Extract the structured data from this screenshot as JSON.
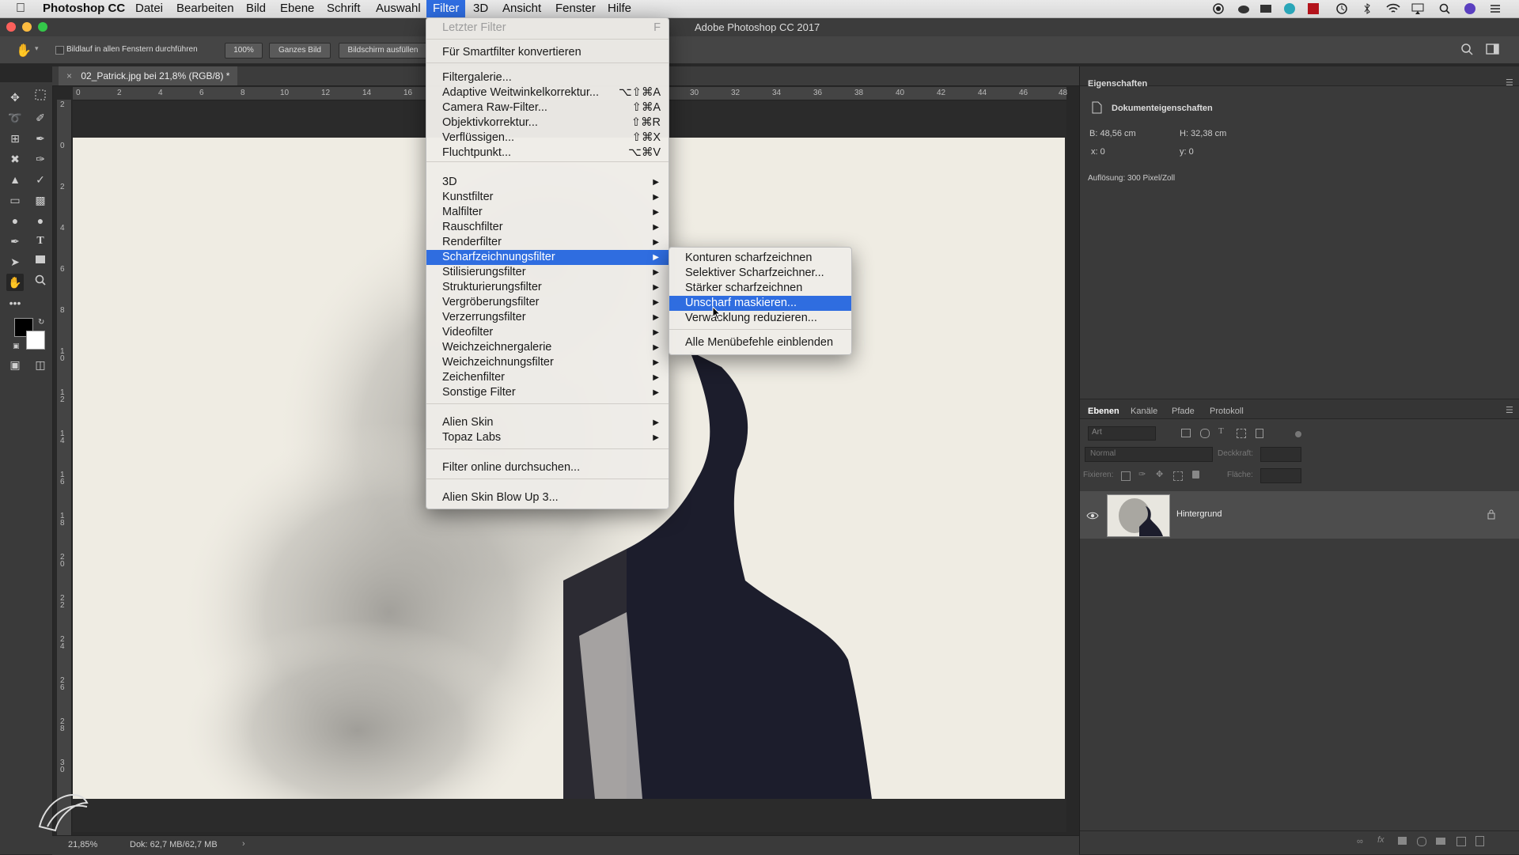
{
  "menubar": {
    "app": "Photoshop CC",
    "items": [
      "Datei",
      "Bearbeiten",
      "Bild",
      "Ebene",
      "Schrift",
      "Auswahl",
      "Filter",
      "3D",
      "Ansicht",
      "Fenster",
      "Hilfe"
    ]
  },
  "window": {
    "title": "Adobe Photoshop CC 2017"
  },
  "options": {
    "scroll_all": "Bildlauf in allen Fenstern durchführen",
    "zoom_btn": "100%",
    "fit_btn": "Ganzes Bild",
    "fill_btn": "Bildschirm ausfüllen"
  },
  "document": {
    "tab": "02_Patrick.jpg bei 21,8% (RGB/8) *",
    "zoom": "21,85%",
    "doc_size": "Dok: 62,7 MB/62,7 MB"
  },
  "hruler": [
    "0",
    "2",
    "4",
    "6",
    "8",
    "10",
    "12",
    "14",
    "16",
    "30",
    "32",
    "34",
    "36",
    "38",
    "40",
    "42",
    "44",
    "46",
    "48"
  ],
  "vruler": [
    "2",
    "0",
    "2",
    "4",
    "6",
    "8",
    "1 0",
    "1 2",
    "1 4",
    "1 6",
    "1 8",
    "2 0",
    "2 2",
    "2 4",
    "2 6",
    "2 8",
    "3 0"
  ],
  "filter_menu": {
    "items": [
      {
        "label": "Letzter Filter",
        "shortcut": "F",
        "disabled": true
      },
      {
        "label": "Für Smartfilter konvertieren"
      },
      {
        "label": "Filtergalerie..."
      },
      {
        "label": "Adaptive Weitwinkelkorrektur...",
        "shortcut": "⌥⇧⌘A"
      },
      {
        "label": "Camera Raw-Filter...",
        "shortcut": "⇧⌘A"
      },
      {
        "label": "Objektivkorrektur...",
        "shortcut": "⇧⌘R"
      },
      {
        "label": "Verflüssigen...",
        "shortcut": "⇧⌘X"
      },
      {
        "label": "Fluchtpunkt...",
        "shortcut": "⌥⌘V"
      },
      {
        "label": "3D",
        "submenu": true
      },
      {
        "label": "Kunstfilter",
        "submenu": true
      },
      {
        "label": "Malfilter",
        "submenu": true
      },
      {
        "label": "Rauschfilter",
        "submenu": true
      },
      {
        "label": "Renderfilter",
        "submenu": true
      },
      {
        "label": "Scharfzeichnungsfilter",
        "submenu": true,
        "selected": true
      },
      {
        "label": "Stilisierungsfilter",
        "submenu": true
      },
      {
        "label": "Strukturierungsfilter",
        "submenu": true
      },
      {
        "label": "Vergröberungsfilter",
        "submenu": true
      },
      {
        "label": "Verzerrungsfilter",
        "submenu": true
      },
      {
        "label": "Videofilter",
        "submenu": true
      },
      {
        "label": "Weichzeichnergalerie",
        "submenu": true
      },
      {
        "label": "Weichzeichnungsfilter",
        "submenu": true
      },
      {
        "label": "Zeichenfilter",
        "submenu": true
      },
      {
        "label": "Sonstige Filter",
        "submenu": true
      },
      {
        "label": "Alien Skin",
        "submenu": true
      },
      {
        "label": "Topaz Labs",
        "submenu": true
      },
      {
        "label": "Filter online durchsuchen..."
      },
      {
        "label": "Alien Skin Blow Up 3..."
      }
    ]
  },
  "sharpen_submenu": {
    "items": [
      {
        "label": "Konturen scharfzeichnen"
      },
      {
        "label": "Selektiver Scharfzeichner..."
      },
      {
        "label": "Stärker scharfzeichnen"
      },
      {
        "label": "Unscharf maskieren...",
        "selected": true
      },
      {
        "label": "Verwacklung reduzieren..."
      },
      {
        "label": "Alle Menübefehle einblenden"
      }
    ]
  },
  "properties": {
    "title": "Eigenschaften",
    "section": "Dokumenteigenschaften",
    "width": "B: 48,56 cm",
    "height": "H: 32,38 cm",
    "x": "x: 0",
    "y": "y: 0",
    "resolution": "Auflösung: 300 Pixel/Zoll"
  },
  "layers_panel": {
    "tabs": [
      "Ebenen",
      "Kanäle",
      "Pfade",
      "Protokoll"
    ],
    "search": "Art",
    "blend": "Normal",
    "opacity_label": "Deckkraft:",
    "lock_label": "Fixieren:",
    "fill_label": "Fläche:",
    "layer_name": "Hintergrund"
  },
  "colors": {
    "accent": "#2f6de0"
  }
}
